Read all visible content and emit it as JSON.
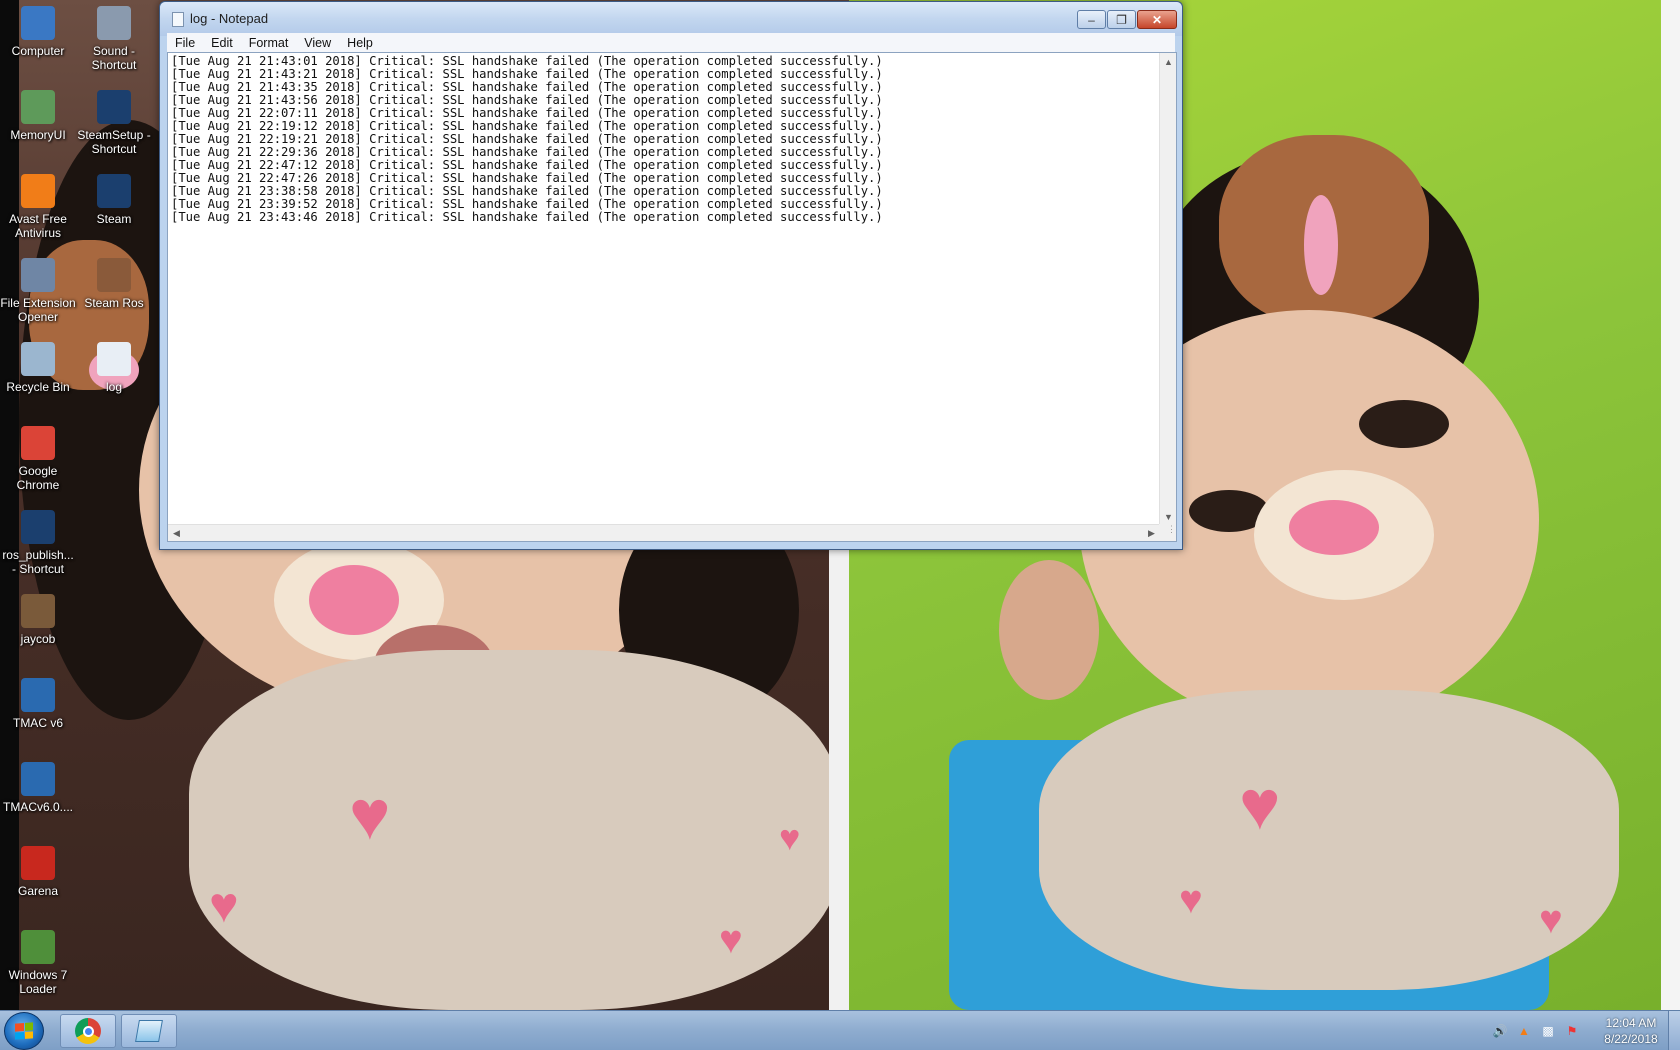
{
  "desktop_icons": [
    {
      "label": "Computer",
      "icon": "computer-icon",
      "color": "#3a78c4"
    },
    {
      "label": "Sound - Shortcut",
      "icon": "sound-shortcut-icon",
      "color": "#8a9aae"
    },
    {
      "label": "MemoryUI",
      "icon": "memoryui-icon",
      "color": "#5e9a5a"
    },
    {
      "label": "SteamSetup - Shortcut",
      "icon": "steam-setup-icon",
      "color": "#1b3f6e"
    },
    {
      "label": "Avast Free Antivirus",
      "icon": "avast-icon",
      "color": "#f17d18"
    },
    {
      "label": "Steam",
      "icon": "steam-icon",
      "color": "#1b3f6e"
    },
    {
      "label": "File Extension Opener",
      "icon": "file-extension-opener-icon",
      "color": "#6f86a5"
    },
    {
      "label": "Steam Ros",
      "icon": "steam-ros-icon",
      "color": "#8a5a3a"
    },
    {
      "label": "Recycle Bin",
      "icon": "recycle-bin-icon",
      "color": "#9bb6cf"
    },
    {
      "label": "log",
      "icon": "text-file-icon",
      "color": "#e8eef5"
    },
    {
      "label": "Google Chrome",
      "icon": "chrome-icon",
      "color": "#db4437"
    },
    {
      "label": "ros_publish... - Shortcut",
      "icon": "ros-publish-icon",
      "color": "#1b3f6e"
    },
    {
      "label": "jaycob",
      "icon": "jaycob-icon",
      "color": "#7a5a3a"
    },
    {
      "label": "TMAC v6",
      "icon": "tmac-icon",
      "color": "#2a6ab0"
    },
    {
      "label": "TMACv6.0....",
      "icon": "tmac-setup-icon",
      "color": "#2a6ab0"
    },
    {
      "label": "Garena",
      "icon": "garena-icon",
      "color": "#c8281e"
    },
    {
      "label": "Windows 7 Loader",
      "icon": "windows-loader-icon",
      "color": "#4f8f3a"
    }
  ],
  "notepad": {
    "title": "log - Notepad",
    "menu": [
      "File",
      "Edit",
      "Format",
      "View",
      "Help"
    ],
    "lines": [
      "[Tue Aug 21 21:43:01 2018] Critical: SSL handshake failed (The operation completed successfully.)",
      "[Tue Aug 21 21:43:21 2018] Critical: SSL handshake failed (The operation completed successfully.)",
      "[Tue Aug 21 21:43:35 2018] Critical: SSL handshake failed (The operation completed successfully.)",
      "[Tue Aug 21 21:43:56 2018] Critical: SSL handshake failed (The operation completed successfully.)",
      "[Tue Aug 21 22:07:11 2018] Critical: SSL handshake failed (The operation completed successfully.)",
      "[Tue Aug 21 22:19:12 2018] Critical: SSL handshake failed (The operation completed successfully.)",
      "[Tue Aug 21 22:19:21 2018] Critical: SSL handshake failed (The operation completed successfully.)",
      "[Tue Aug 21 22:29:36 2018] Critical: SSL handshake failed (The operation completed successfully.)",
      "[Tue Aug 21 22:47:12 2018] Critical: SSL handshake failed (The operation completed successfully.)",
      "[Tue Aug 21 22:47:26 2018] Critical: SSL handshake failed (The operation completed successfully.)",
      "[Tue Aug 21 23:38:58 2018] Critical: SSL handshake failed (The operation completed successfully.)",
      "[Tue Aug 21 23:39:52 2018] Critical: SSL handshake failed (The operation completed successfully.)",
      "[Tue Aug 21 23:43:46 2018] Critical: SSL handshake failed (The operation completed successfully.)"
    ]
  },
  "taskbar": {
    "pinned": [
      {
        "name": "chrome-taskbar-button",
        "icon": "chrome-icon"
      },
      {
        "name": "notepad-taskbar-button",
        "icon": "notepad-icon"
      }
    ],
    "tray_icons": [
      "volume-icon",
      "avast-tray-icon",
      "network-icon",
      "action-center-icon"
    ],
    "clock_time": "12:04 AM",
    "clock_date": "8/22/2018"
  }
}
